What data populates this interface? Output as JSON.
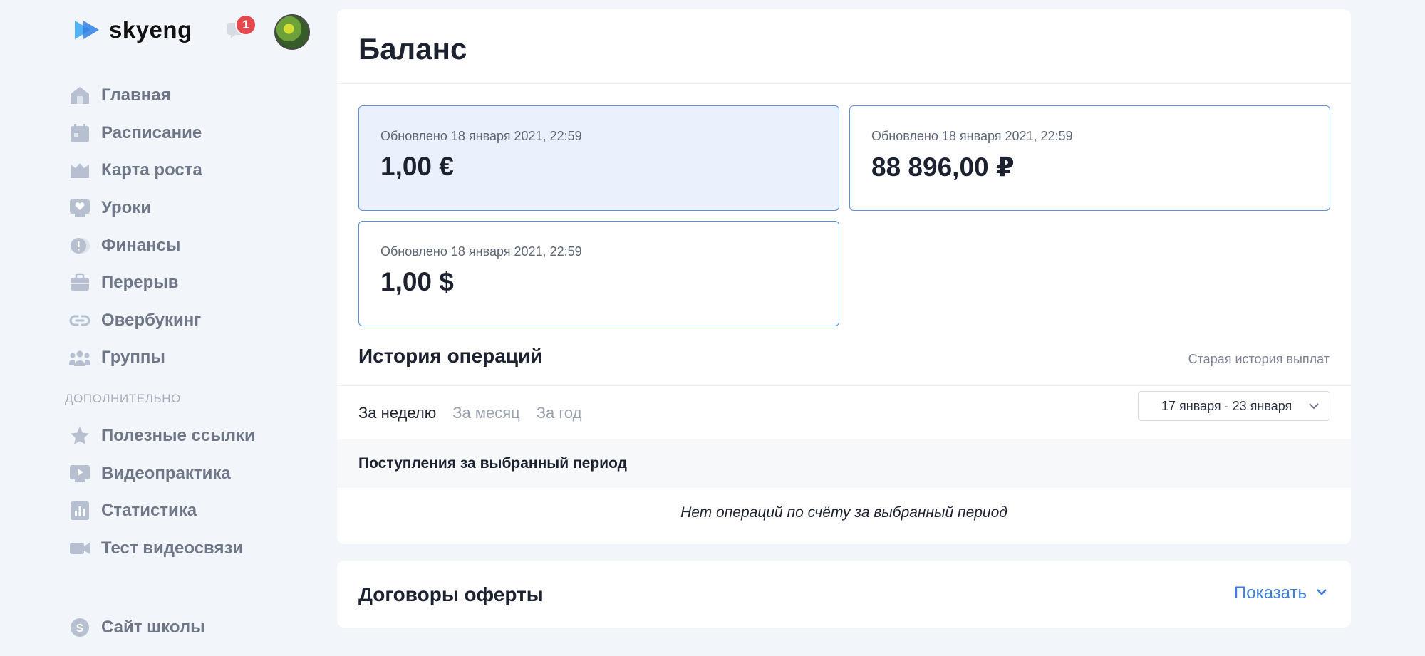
{
  "brand": {
    "name": "skyeng"
  },
  "notifications": {
    "count": "1"
  },
  "sidebar": {
    "items": [
      {
        "label": "Главная",
        "icon": "home-icon"
      },
      {
        "label": "Расписание",
        "icon": "calendar-icon"
      },
      {
        "label": "Карта роста",
        "icon": "crown-icon"
      },
      {
        "label": "Уроки",
        "icon": "lessons-heart-icon"
      },
      {
        "label": "Финансы",
        "icon": "coin-icon"
      },
      {
        "label": "Перерыв",
        "icon": "suitcase-icon"
      },
      {
        "label": "Овербукинг",
        "icon": "link-icon"
      },
      {
        "label": "Группы",
        "icon": "group-icon"
      }
    ],
    "section_label": "ДОПОЛНИТЕЛЬНО",
    "extra_items": [
      {
        "label": "Полезные ссылки",
        "icon": "star-icon"
      },
      {
        "label": "Видеопрактика",
        "icon": "play-icon"
      },
      {
        "label": "Статистика",
        "icon": "stats-icon"
      },
      {
        "label": "Тест видеосвязи",
        "icon": "camera-icon"
      }
    ],
    "footer_item": {
      "label": "Сайт школы",
      "icon": "school-site-icon"
    }
  },
  "main": {
    "title": "Баланс",
    "balances": [
      {
        "updated": "Обновлено 18 января 2021, 22:59",
        "amount": "1,00 €"
      },
      {
        "updated": "Обновлено 18 января 2021, 22:59",
        "amount": "88 896,00 ₽"
      },
      {
        "updated": "Обновлено 18 января 2021, 22:59",
        "amount": "1,00 $"
      }
    ],
    "history": {
      "title": "История операций",
      "old_history_link": "Старая история выплат",
      "tabs": [
        "За неделю",
        "За месяц",
        "За год"
      ],
      "date_range": "17 января - 23 января",
      "period_heading": "Поступления за выбранный период",
      "empty_text": "Нет операций по счёту за выбранный период"
    },
    "offer": {
      "title": "Договоры оферты",
      "show_label": "Показать"
    }
  },
  "colors": {
    "accent": "#3f7fdc",
    "card_border": "#5b8fe0",
    "active_card_bg": "#ebf1fc",
    "badge": "#e5484d",
    "nav_icon": "#b7c0d0"
  }
}
